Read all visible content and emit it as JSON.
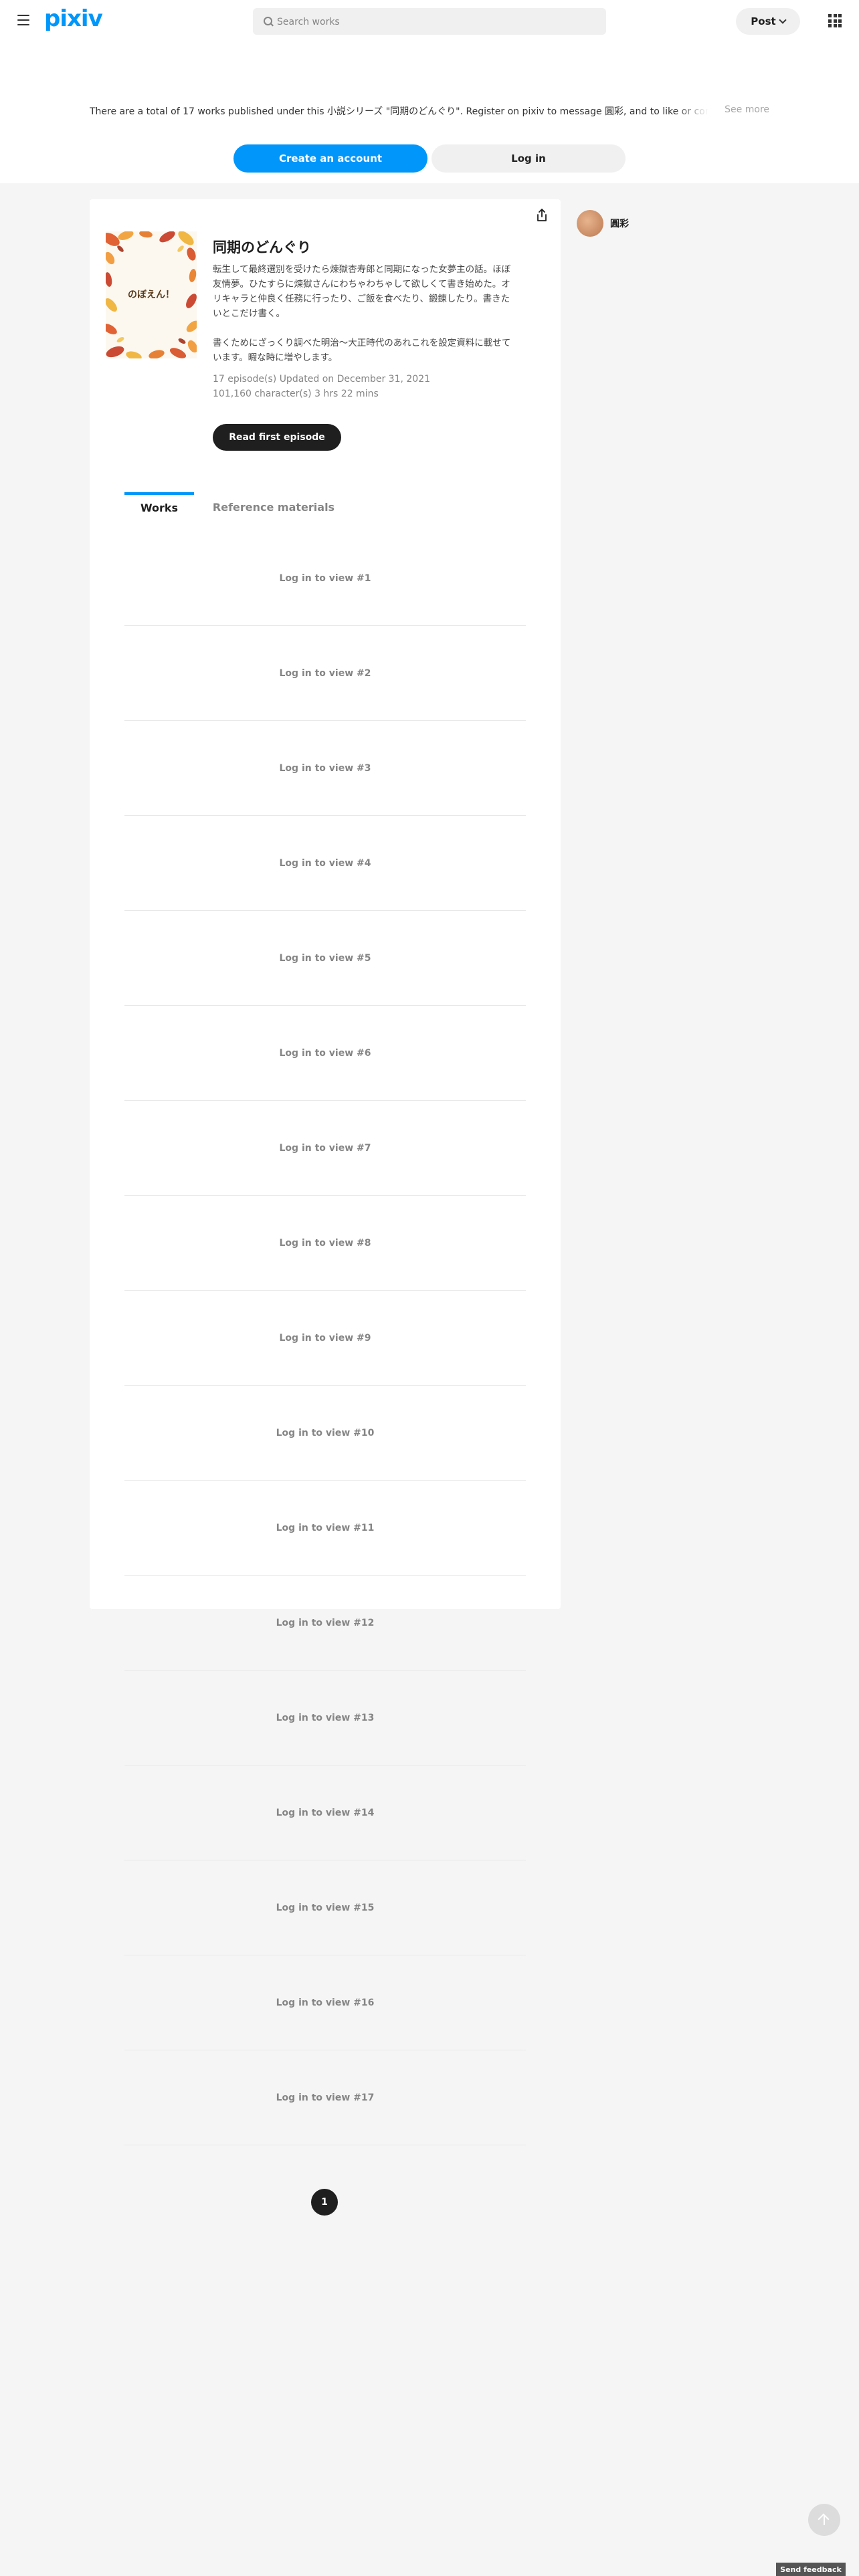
{
  "header": {
    "logo": "pixiv",
    "search_placeholder": "Search works",
    "post_label": "Post"
  },
  "notice": {
    "text": "There are a total of 17 works published under this 小説シリーズ \"同期のどんぐり\". Register on pixiv to message 圓彩, and to like or comment on their works.",
    "see_more": "See more"
  },
  "auth": {
    "create_account": "Create an account",
    "login": "Log in"
  },
  "series": {
    "cover_text": "のぼえん！",
    "title": "同期のどんぐり",
    "description_1": "転生して最終選別を受けたら煉獄杏寿郎と同期になった女夢主の話。ほぼ友情夢。ひたすらに煉獄さんにわちゃわちゃして欲しくて書き始めた。オリキャラと仲良く任務に行ったり、ご飯を食べたり、鍛錬したり。書きたいとこだけ書く。",
    "description_2": "書くためにざっくり調べた明治〜大正時代のあれこれを設定資料に載せています。暇な時に増やします。",
    "episodes": "17 episode(s)",
    "updated": "Updated on December 31, 2021",
    "characters": "101,160 character(s)",
    "reading_time": "3 hrs 22 mins",
    "read_first": "Read first episode"
  },
  "tabs": {
    "works": "Works",
    "reference": "Reference materials"
  },
  "works": [
    "Log in to view #1",
    "Log in to view #2",
    "Log in to view #3",
    "Log in to view #4",
    "Log in to view #5",
    "Log in to view #6",
    "Log in to view #7",
    "Log in to view #8",
    "Log in to view #9",
    "Log in to view #10",
    "Log in to view #11",
    "Log in to view #12",
    "Log in to view #13",
    "Log in to view #14",
    "Log in to view #15",
    "Log in to view #16",
    "Log in to view #17"
  ],
  "pagination": {
    "current": "1"
  },
  "author": {
    "name": "圓彩"
  },
  "footer": {
    "feedback": "Send feedback"
  },
  "colors": {
    "accent": "#0096fa",
    "dark": "#1f1f1f",
    "background": "#f5f5f5"
  }
}
